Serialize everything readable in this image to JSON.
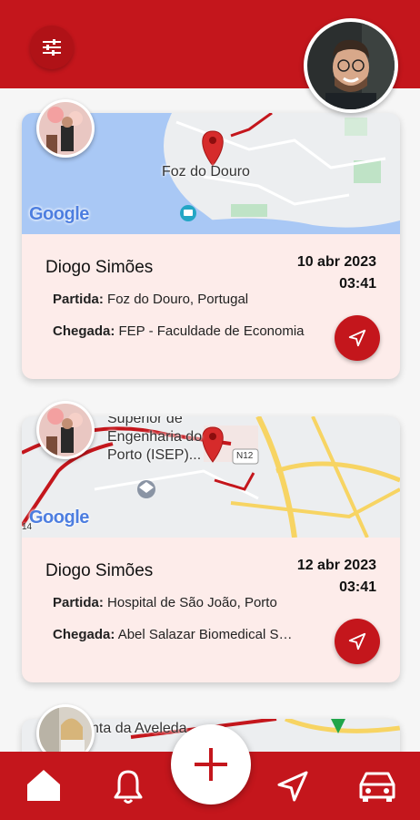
{
  "header": {
    "filter_icon": "sliders-icon",
    "profile_avatar": "user-avatar"
  },
  "trips": [
    {
      "map_label": "Foz do Douro",
      "map_logo": "Google",
      "driver": "Diogo Simões",
      "date": "10 abr 2023",
      "time": "03:41",
      "departure_label": "Partida:",
      "departure": "Foz do Douro, Portugal",
      "arrival_label": "Chegada:",
      "arrival": "FEP - Faculdade de Economia"
    },
    {
      "map_label_1": "Superior de",
      "map_label_2": "Engenharia do",
      "map_label_3": "Porto (ISEP)...",
      "map_road": "N12",
      "map_edge": "14",
      "map_logo": "Google",
      "driver": "Diogo Simões",
      "date": "12 abr 2023",
      "time": "03:41",
      "departure_label": "Partida:",
      "departure": "Hospital de São João, Porto",
      "arrival_label": "Chegada:",
      "arrival": "Abel Salazar Biomedical Sciences Institute"
    },
    {
      "map_label": "nta da Aveleda"
    }
  ],
  "bottom_nav": {
    "items": [
      "home-icon",
      "bell-icon",
      "add-icon",
      "navigation-icon",
      "car-icon"
    ],
    "fab_symbol": "+"
  },
  "colors": {
    "primary": "#c4161c",
    "card_bg": "#fdecea",
    "water": "#a9c8f5",
    "road": "#f7d463"
  }
}
